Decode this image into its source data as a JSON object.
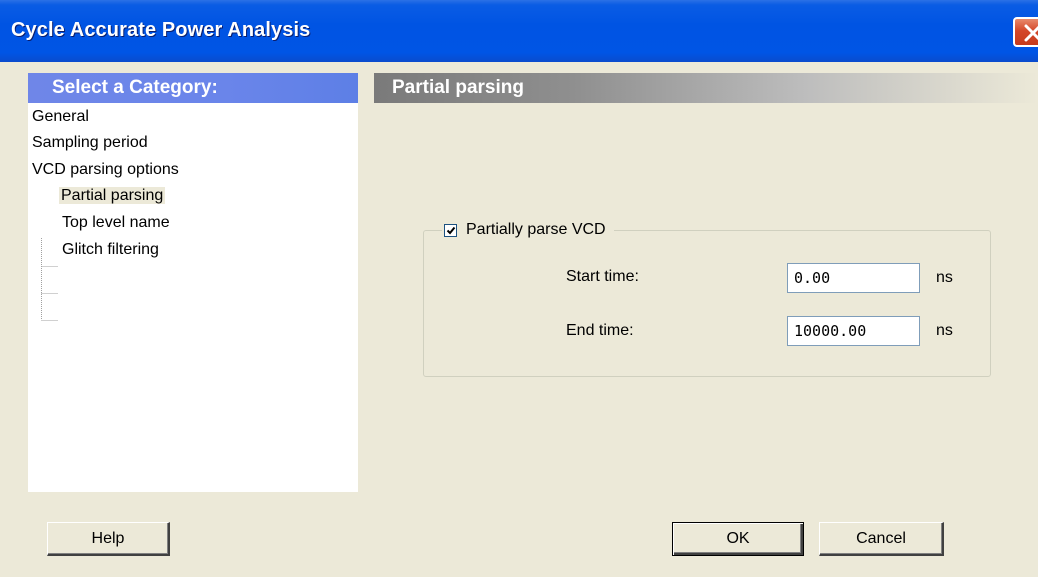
{
  "window": {
    "title": "Cycle Accurate Power Analysis"
  },
  "categories": {
    "header": "Select a Category:",
    "items": [
      {
        "label": "General",
        "level": 0
      },
      {
        "label": "Sampling period",
        "level": 0
      },
      {
        "label": "VCD parsing options",
        "level": 0
      },
      {
        "label": "Partial parsing",
        "level": 1,
        "selected": true
      },
      {
        "label": "Top level name",
        "level": 1
      },
      {
        "label": "Glitch filtering",
        "level": 1
      }
    ]
  },
  "panel": {
    "title": "Partial parsing",
    "group": {
      "label": "Partially parse VCD",
      "checked": true
    },
    "start_time": {
      "label": "Start time:",
      "value": "0.00",
      "unit": "ns"
    },
    "end_time": {
      "label": "End time:",
      "value": "10000.00",
      "unit": "ns"
    }
  },
  "buttons": {
    "help": "Help",
    "ok": "OK",
    "cancel": "Cancel"
  },
  "colors": {
    "titlebar": "#0054e3",
    "category_header": "#6a85ea",
    "dialog_bg": "#ece9d8"
  }
}
